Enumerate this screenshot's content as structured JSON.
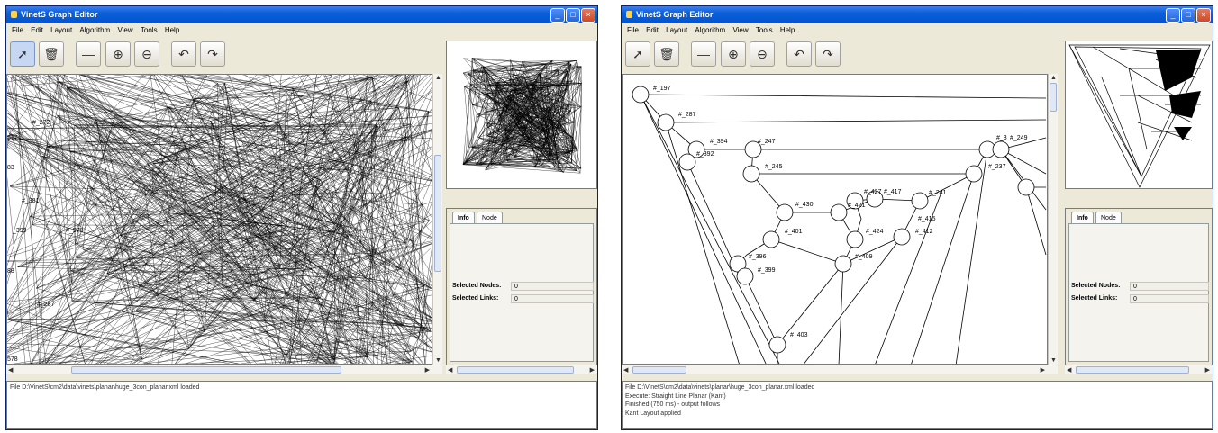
{
  "windows": [
    {
      "title": "VinetS Graph Editor",
      "menu": [
        "File",
        "Edit",
        "Layout",
        "Algorithm",
        "View",
        "Tools",
        "Help"
      ],
      "tabs": [
        "Info",
        "Node"
      ],
      "selected_nodes_label": "Selected Nodes:",
      "selected_links_label": "Selected Links:",
      "selected_nodes_value": "0",
      "selected_links_value": "0",
      "node_labels": [
        "#_272",
        "517",
        "83",
        "#_381",
        "_399",
        "#_578",
        "88",
        "#_287",
        "578"
      ],
      "log": [
        "File D:\\VinetS\\cm2\\data\\vinets\\planar\\huge_3con_planar.xml loaded"
      ]
    },
    {
      "title": "VinetS Graph Editor",
      "menu": [
        "File",
        "Edit",
        "Layout",
        "Algorithm",
        "View",
        "Tools",
        "Help"
      ],
      "tabs": [
        "Info",
        "Node"
      ],
      "selected_nodes_label": "Selected Nodes:",
      "selected_links_label": "Selected Links:",
      "selected_nodes_value": "0",
      "selected_links_value": "0",
      "node_labels": [
        "#_197",
        "#_287",
        "#_394",
        "#_392",
        "#_247",
        "#_245",
        "#_430",
        "#_401",
        "#_427",
        "#_417",
        "#_421",
        "#_241",
        "#_424",
        "#_415",
        "#_412",
        "#_409",
        "#_396",
        "#_399",
        "#_403",
        "#_3",
        "#_249",
        "#_237"
      ],
      "log": [
        "File D:\\VinetS\\cm2\\data\\vinets\\planar\\huge_3con_planar.xml loaded",
        "Execute: Straight Line Planar (Kant)",
        "Finished (750 ms) - output follows",
        "Kant Layout applied"
      ]
    }
  ]
}
